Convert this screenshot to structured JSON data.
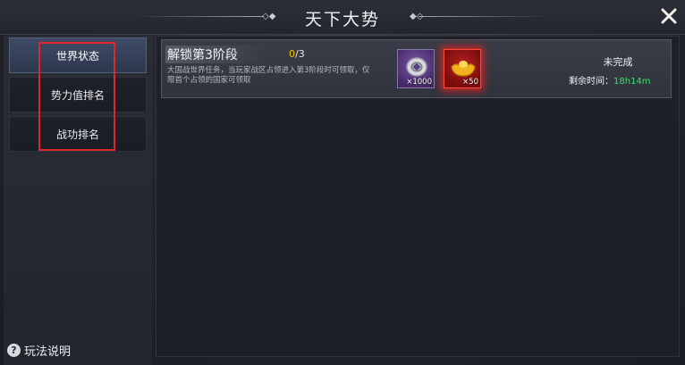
{
  "header": {
    "title": "天下大势",
    "close_icon": "close-icon"
  },
  "sidebar": {
    "items": [
      {
        "label": "世界状态",
        "active": true
      },
      {
        "label": "势力值排名",
        "active": false
      },
      {
        "label": "战功排名",
        "active": false
      }
    ],
    "help_label": "玩法说明",
    "help_icon": "question-icon"
  },
  "task": {
    "title": "解锁第3阶段",
    "progress_current": "0",
    "progress_total": "/3",
    "description": "大国战世界任务，当玩家战区占领进入第3阶段时可领取，仅限首个占领的国家可领取",
    "rewards": [
      {
        "icon": "purple-coin-icon",
        "count": "×1000"
      },
      {
        "icon": "gold-ingot-icon",
        "count": "×50"
      }
    ],
    "status": "未完成",
    "remaining_label": "剩余时间：",
    "remaining_time": "18h14m"
  },
  "colors": {
    "highlight": "#e0262c",
    "progress_current": "#f2c200",
    "remaining_time": "#36e06a",
    "active_tab": "#3f4b66"
  }
}
